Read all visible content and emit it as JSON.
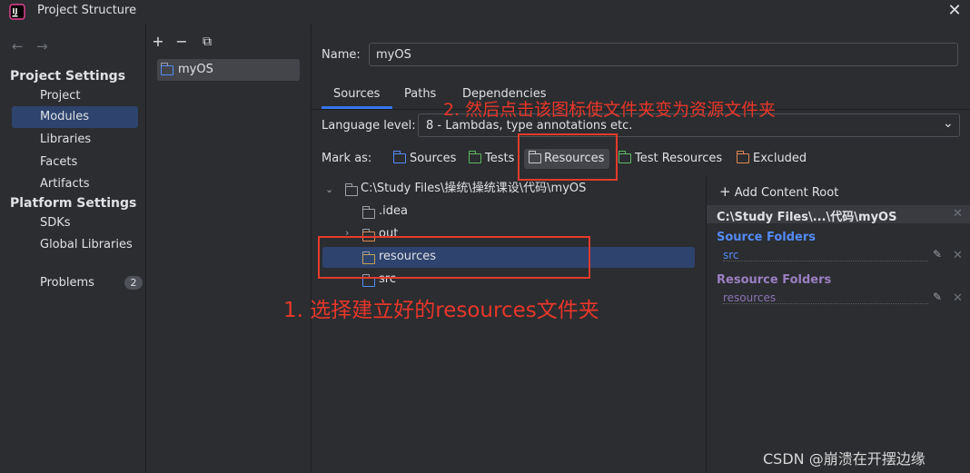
{
  "window": {
    "title": "Project Structure"
  },
  "nav": {
    "project_settings_header": "Project Settings",
    "project_items": [
      "Project",
      "Modules",
      "Libraries",
      "Facets",
      "Artifacts"
    ],
    "platform_settings_header": "Platform Settings",
    "platform_items": [
      "SDKs",
      "Global Libraries"
    ],
    "problems_label": "Problems",
    "problems_count": "2",
    "selected": "Modules"
  },
  "module_panel": {
    "toolbar": [
      "+",
      "−",
      "⧉"
    ],
    "module_name": "myOS"
  },
  "editor": {
    "name_label": "Name:",
    "name_value": "myOS",
    "tabs": [
      "Sources",
      "Paths",
      "Dependencies"
    ],
    "active_tab": "Sources",
    "language_level_label": "Language level:",
    "language_level_value": "8 - Lambdas, type annotations etc.",
    "mark_as_label": "Mark as:",
    "mark_as": [
      {
        "label": "Sources",
        "color": "#548af7"
      },
      {
        "label": "Tests",
        "color": "#5fb865"
      },
      {
        "label": "Resources",
        "color": "#c7a450"
      },
      {
        "label": "Test Resources",
        "color": "#5fb865"
      },
      {
        "label": "Excluded",
        "color": "#e08855"
      }
    ]
  },
  "tree": {
    "root": "C:\\Study Files\\操统\\操统课设\\代码\\myOS",
    "children": [
      ".idea",
      "out",
      "resources",
      "src"
    ],
    "selected": "resources"
  },
  "content_root": {
    "add_label": "Add Content Root",
    "path": "C:\\Study Files\\...\\代码\\myOS",
    "source_folders_label": "Source Folders",
    "source_folders": [
      "src"
    ],
    "resource_folders_label": "Resource Folders",
    "resource_folders": [
      "resources"
    ],
    "source_color": "#548af7",
    "resource_color": "#9b7fc2"
  },
  "annotations": {
    "step1": "1. 选择建立好的resources文件夹",
    "step2": "2. 然后点击该图标使文件夹变为资源文件夹",
    "watermark": "CSDN @崩溃在开摆边缘",
    "color": "#e53a2b"
  }
}
